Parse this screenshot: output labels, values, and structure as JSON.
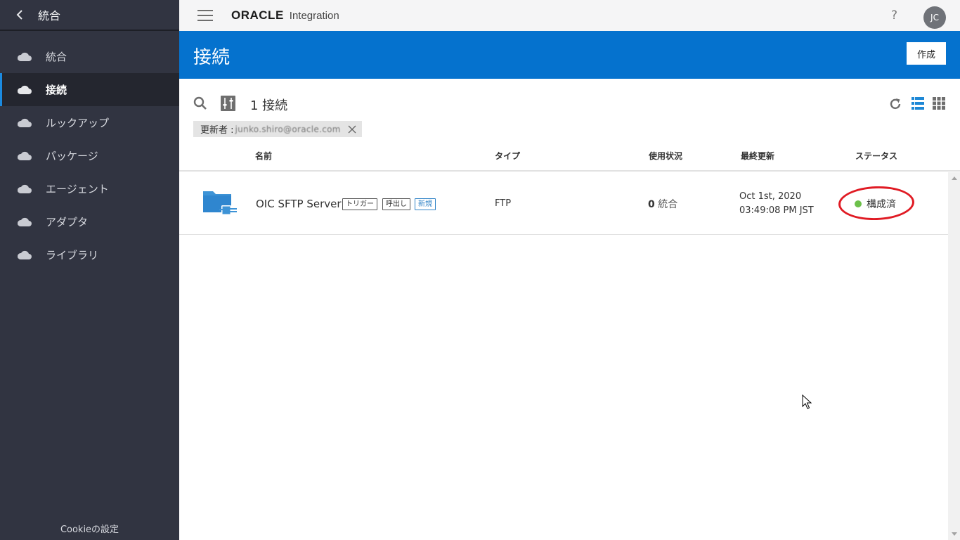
{
  "sidebar": {
    "title": "統合",
    "items": [
      {
        "label": "統合",
        "icon": "cloud-icon",
        "active": false
      },
      {
        "label": "接続",
        "icon": "cloud-icon",
        "active": true
      },
      {
        "label": "ルックアップ",
        "icon": "cloud-icon",
        "active": false
      },
      {
        "label": "パッケージ",
        "icon": "cloud-icon",
        "active": false
      },
      {
        "label": "エージェント",
        "icon": "cloud-icon",
        "active": false
      },
      {
        "label": "アダプタ",
        "icon": "cloud-icon",
        "active": false
      },
      {
        "label": "ライブラリ",
        "icon": "cloud-icon",
        "active": false
      }
    ],
    "footer": "Cookieの設定"
  },
  "topbar": {
    "brand": "ORACLE",
    "product": "Integration",
    "help": "?",
    "avatar": "JC"
  },
  "page": {
    "title": "接続",
    "create_label": "作成"
  },
  "toolbar": {
    "count_label": "1 接続",
    "filter_chip": {
      "label": "更新者 : ",
      "value": "junko.shiro@oracle.com"
    }
  },
  "table": {
    "columns": [
      "名前",
      "タイプ",
      "使用状況",
      "最終更新",
      "ステータス"
    ],
    "rows": [
      {
        "name": "OIC SFTP Server",
        "tags": [
          "トリガー",
          "呼出し",
          "新規"
        ],
        "type": "FTP",
        "usage_count": "0",
        "usage_unit": "統合",
        "updated_date": "Oct 1st, 2020",
        "updated_time": "03:49:08 PM JST",
        "status": "構成済"
      }
    ]
  },
  "colors": {
    "sidebar_bg": "#313441",
    "header_blue": "#0572ce",
    "status_green": "#6cc04a",
    "annotation_red": "#e01b24"
  }
}
